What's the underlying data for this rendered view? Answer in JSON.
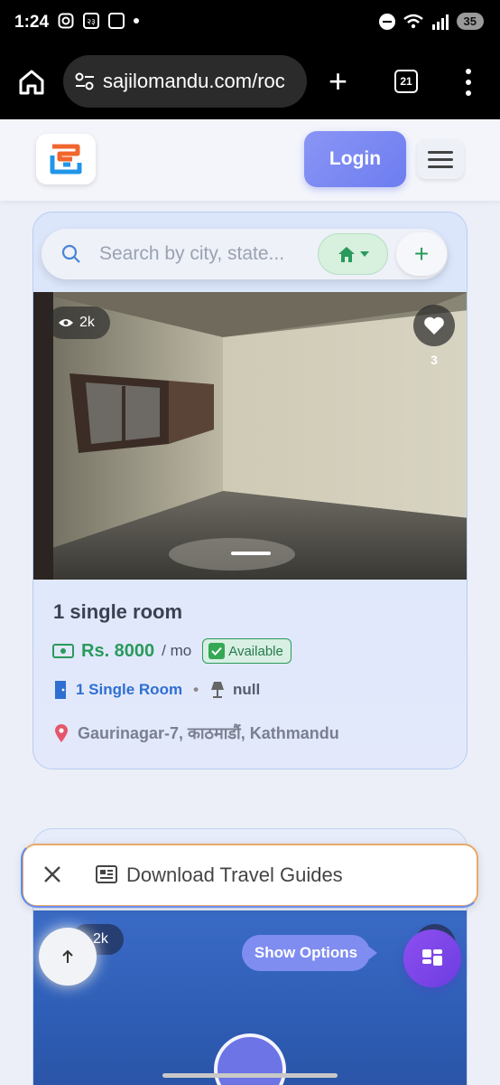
{
  "status_bar": {
    "time": "1:24",
    "notif_badge": "२३",
    "battery": "35"
  },
  "browser": {
    "url": "sajilomandu.com/roc",
    "tab_count": "21"
  },
  "header": {
    "login_label": "Login"
  },
  "search": {
    "placeholder": "Search by city, state..."
  },
  "listing": {
    "views": "2k",
    "likes": "3",
    "title": "1 single room",
    "price": "Rs. 8000",
    "period": "/ mo",
    "status": "Available",
    "room_type": "1 Single Room",
    "separator": "•",
    "furnishing": "null",
    "location": "Gaurinagar-7, काठमाडौं, Kathmandu"
  },
  "listing2": {
    "views": "2k"
  },
  "banner": {
    "text": "Download Travel Guides"
  },
  "fab": {
    "show_options_label": "Show Options"
  },
  "colors": {
    "accent": "#7f8cf0",
    "price_green": "#2a9a5c",
    "room_blue": "#2f6fd1",
    "fab_purple": "#7a45e8"
  },
  "icons": [
    "instagram-icon",
    "screenshot-icon",
    "dnd-icon",
    "wifi-icon",
    "signal-icon",
    "home-icon",
    "site-settings-icon",
    "plus-icon",
    "tabs-icon",
    "menu-icon",
    "logo-icon",
    "hamburger-icon",
    "search-icon",
    "house-filter-icon",
    "eye-icon",
    "heart-icon",
    "cash-icon",
    "check-icon",
    "door-icon",
    "lamp-icon",
    "location-pin-icon",
    "close-icon",
    "newspaper-icon",
    "arrow-up-icon",
    "options-icon"
  ]
}
